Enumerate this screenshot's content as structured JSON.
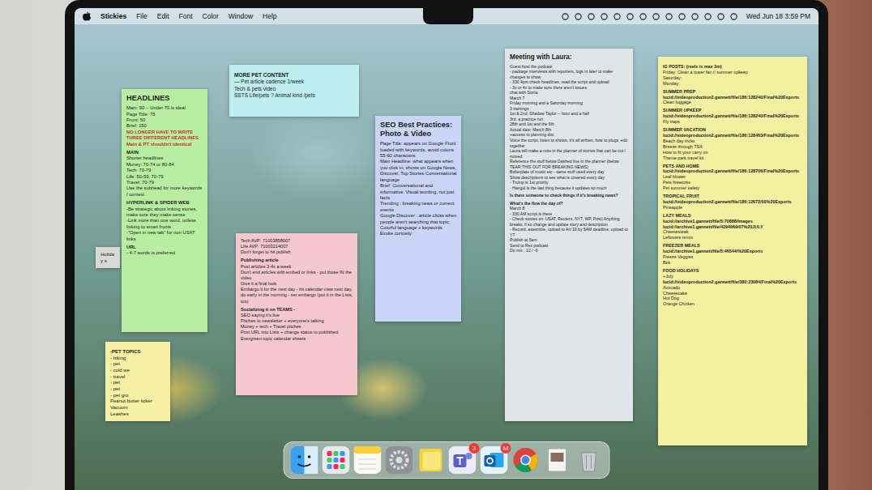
{
  "menubar": {
    "app": "Stickies",
    "menus": [
      "File",
      "Edit",
      "Font",
      "Color",
      "Window",
      "Help"
    ],
    "clock": "Wed Jun 18  3:59 PM"
  },
  "stickies": [
    {
      "color": "#d9d9d6",
      "lines": [
        {
          "text": "Holiday s",
          "kind": "text"
        }
      ]
    },
    {
      "color": "#f5f0a4",
      "lines": [
        {
          "text": "-PET TOPICS",
          "kind": "head"
        },
        {
          "text": "- hiking",
          "kind": "text"
        },
        {
          "text": "- pet",
          "kind": "text"
        },
        {
          "text": "- cold we",
          "kind": "text"
        },
        {
          "text": "- travel",
          "kind": "text"
        },
        {
          "text": "- pet",
          "kind": "text"
        },
        {
          "text": "- pet",
          "kind": "text"
        },
        {
          "text": "- pet gro",
          "kind": "text"
        },
        {
          "text": "Peanut butter licker",
          "kind": "text"
        },
        {
          "text": "Vacuum",
          "kind": "text"
        },
        {
          "text": "Leashes",
          "kind": "text"
        }
      ]
    },
    {
      "color": "#b8eea2",
      "lines": [
        {
          "text": "HEADLINES",
          "kind": "title"
        },
        {
          "text": "Main: 90 -- Under 70 is ideal",
          "kind": "text"
        },
        {
          "text": "Page Title: 75",
          "kind": "text"
        },
        {
          "text": "Front: 50",
          "kind": "text"
        },
        {
          "text": "Brief: 150",
          "kind": "text"
        },
        {
          "text": "NO LONGER HAVE TO WRITE THREE DIFFERENT HEADLINES",
          "kind": "red"
        },
        {
          "text": "Main & PT shouldn't identical",
          "kind": "red"
        },
        {
          "text": "MAIN",
          "kind": "head"
        },
        {
          "text": "Shorter headlines",
          "kind": "text"
        },
        {
          "text": "Money: 70-74 or 80-84",
          "kind": "text"
        },
        {
          "text": "Tech: 70-79",
          "kind": "text"
        },
        {
          "text": "Life: 50-59, 70-79",
          "kind": "text"
        },
        {
          "text": "Travel: 70-79",
          "kind": "text"
        },
        {
          "text": "Use the subhead for more keywords / context",
          "kind": "text"
        },
        {
          "text": "HYPERLINK & SPIDER WEB",
          "kind": "head"
        },
        {
          "text": "-Be strategic about linking stories, make sure they make sense",
          "kind": "text"
        },
        {
          "text": "-Link more than one word, unless linking to smart fronts",
          "kind": "text"
        },
        {
          "text": "-\"Open in new tab\" for non USAT links",
          "kind": "text"
        },
        {
          "text": "URL",
          "kind": "head"
        },
        {
          "text": "- 4-7 words is preferred",
          "kind": "text"
        }
      ]
    },
    {
      "color": "#bfeef0",
      "lines": [
        {
          "text": "MORE PET CONTENT",
          "kind": "head"
        },
        {
          "text": "— Pet article cadence 1/week",
          "kind": "text"
        },
        {
          "text": "Tech & pets video",
          "kind": "text"
        },
        {
          "text": "SSTS Life/pets ? Animal kind /pets",
          "kind": "text"
        }
      ]
    },
    {
      "color": "#f5c8d0",
      "lines": [
        {
          "text": "Tech AVP: 71003858007",
          "kind": "text"
        },
        {
          "text": "Life AVP: 71003214007",
          "kind": "text"
        },
        {
          "text": "Don't forget to hit publish",
          "kind": "text"
        },
        {
          "text": "Publishing article",
          "kind": "head"
        },
        {
          "text": "Post articles 3-4x a week",
          "kind": "text"
        },
        {
          "text": "Don't end articles with embed or links - put those IN the video",
          "kind": "text"
        },
        {
          "text": "Give it a final look",
          "kind": "text"
        },
        {
          "text": "Embargo it for the next day - hit calendar view next day, do early in the morning - set embargo (put it in the Lists, too)",
          "kind": "text"
        },
        {
          "text": "Socializing it on TEAMS -",
          "kind": "head"
        },
        {
          "text": "SEO saying it's live",
          "kind": "text"
        },
        {
          "text": "Pitches to newsletter + everyone's talking",
          "kind": "text"
        },
        {
          "text": "Money + tech + Travel pitches",
          "kind": "text"
        },
        {
          "text": "Post URL into Lists + change status to published",
          "kind": "text"
        },
        {
          "text": "Evergreen topic calendar sheets",
          "kind": "text"
        }
      ]
    },
    {
      "color": "#c9d4f6",
      "lines": [
        {
          "text": "SEO Best Practices: Photo & Video",
          "kind": "title"
        },
        {
          "text": "Page Title: appears on Google Front loaded with keywords, avoid colons 55-60 characters",
          "kind": "text"
        },
        {
          "text": "Main Headline: what appears when you click in, shows on Google News, Discover, Top Stories Conversational language",
          "kind": "text"
        },
        {
          "text": "Brief: Conversational and informative. Visual wording, not just facts",
          "kind": "text"
        },
        {
          "text": "Trending : breaking news or current events",
          "kind": "text"
        },
        {
          "text": "Google Discover : article clicks when people aren't searching that topic. Colorful language + keywords",
          "kind": "text"
        },
        {
          "text": "Evoke curiosity",
          "kind": "text"
        }
      ]
    },
    {
      "color": "#e2e5e8",
      "lines": [
        {
          "text": "Meeting with Laura:",
          "kind": "title"
        },
        {
          "text": "Guest host the podcast",
          "kind": "text"
        },
        {
          "text": "- package interviews with reporters, logs in later to make changes to show",
          "kind": "text"
        },
        {
          "text": "- 330 4pm check headlines, read the script and upload",
          "kind": "text"
        },
        {
          "text": "- 3x or 4x to make sure there aren't issues",
          "kind": "text"
        },
        {
          "text": "chat with Sonia",
          "kind": "text"
        },
        {
          "text": "March 7",
          "kind": "text"
        },
        {
          "text": "Friday morning and a Saturday morning",
          "kind": "text"
        },
        {
          "text": "3 trainings",
          "kind": "text"
        },
        {
          "text": "1st & 2nd: Shadow Taylor -- hour and a half",
          "kind": "text"
        },
        {
          "text": "3rd: a practice run",
          "kind": "text"
        },
        {
          "text": "28th and 1st and the 6th",
          "kind": "text"
        },
        {
          "text": "Actual date: March 8th",
          "kind": "text"
        },
        {
          "text": "+access to planning doc",
          "kind": "text"
        },
        {
          "text": "Voice the script, listen to shows, it's all written, how to plugs, edit together",
          "kind": "text"
        },
        {
          "text": "Laura will make a note in the planner of stories that can be cut / moved",
          "kind": "text"
        },
        {
          "text": "Reference the stuff below Dashed line in the planner (below TEAR THIS OUT FOR BREAKING NEWS)",
          "kind": "text"
        },
        {
          "text": "Boilerplate of music etc - same stuff used every day",
          "kind": "text"
        },
        {
          "text": "Show descriptions to see what is covered every day",
          "kind": "text"
        },
        {
          "text": "- Trump is 1st priority",
          "kind": "text"
        },
        {
          "text": "- Hangul is the last thing because it updates so much",
          "kind": "text"
        },
        {
          "text": "Is there someone to check things if it's breaking news?",
          "kind": "head"
        },
        {
          "text": "What's the flow the day of?",
          "kind": "head"
        },
        {
          "text": "March 8",
          "kind": "text"
        },
        {
          "text": "- 330 AM script is there",
          "kind": "text"
        },
        {
          "text": "- Check stories on: USAT, Reuters, NYT, WP, Post) Anything breaks, if so change and update story and description",
          "kind": "text"
        },
        {
          "text": "- Record, assemble, upload to Art 19 by 5AM deadline, upload to YT",
          "kind": "text"
        },
        {
          "text": "Publish at 5am",
          "kind": "text"
        },
        {
          "text": "Send to Rex podcast",
          "kind": "text"
        },
        {
          "text": "Do mix : 12 / -6",
          "kind": "text"
        }
      ]
    },
    {
      "color": "#f4f0a2",
      "lines": [
        {
          "text": "IG POSTS: (reels is max 3m)",
          "kind": "head"
        },
        {
          "text": "Friday: Clean a tower fan // summer upkeep",
          "kind": "text"
        },
        {
          "text": "Saturday:",
          "kind": "text"
        },
        {
          "text": "Monday:",
          "kind": "text"
        },
        {
          "text": "SUMMER PREP",
          "kind": "head"
        },
        {
          "text": "lucid://videoproduction2.gannett/file/186:128240/Final%20Exports",
          "kind": "link"
        },
        {
          "text": "Clean luggage",
          "kind": "text"
        },
        {
          "text": "SUMMER UPKEEP",
          "kind": "head"
        },
        {
          "text": "lucid://videoproduction2.gannett/file/186:128240/Final%20Exports",
          "kind": "link"
        },
        {
          "text": "Fly traps",
          "kind": "text"
        },
        {
          "text": "SUMMER VACATION",
          "kind": "head"
        },
        {
          "text": "lucid://videoproduction2.gannett/file/186:128463/Final%20Exports",
          "kind": "link"
        },
        {
          "text": "Beach day tricks",
          "kind": "text"
        },
        {
          "text": "Breeze through TSA",
          "kind": "text"
        },
        {
          "text": "How to fit your carry on",
          "kind": "text"
        },
        {
          "text": "Theme park travel kit",
          "kind": "text"
        },
        {
          "text": "PETS AND HOME",
          "kind": "head"
        },
        {
          "text": "lucid://videoproduction2.gannett/file/186:128706/Final%20Exports",
          "kind": "link"
        },
        {
          "text": "Leaf blower",
          "kind": "text"
        },
        {
          "text": "Pets fireworks",
          "kind": "text"
        },
        {
          "text": "Pet summer safety",
          "kind": "text"
        },
        {
          "text": "TROPICAL FRUIT",
          "kind": "head"
        },
        {
          "text": "lucid://videoproduction2.gannett/file/186:12672/00%20Exports",
          "kind": "link"
        },
        {
          "text": "Pineapple",
          "kind": "text"
        },
        {
          "text": "LAZY MEALS",
          "kind": "head"
        },
        {
          "text": "lucid://archive1.gannett/file/5:70888/Images",
          "kind": "link"
        },
        {
          "text": "lucid://archive1.gannett/file/4294069/07%20JULY",
          "kind": "link"
        },
        {
          "text": "Cheesesteak",
          "kind": "text"
        },
        {
          "text": "Leftovers remix",
          "kind": "text"
        },
        {
          "text": "FREEZER MEALS",
          "kind": "head"
        },
        {
          "text": "lucid://archive1.gannett/file/5:46544/%20Exports",
          "kind": "link"
        },
        {
          "text": "Freeze Veggies",
          "kind": "text"
        },
        {
          "text": "Bok",
          "kind": "text"
        },
        {
          "text": "FOOD HOLIDAYS",
          "kind": "head"
        },
        {
          "text": "+July",
          "kind": "text"
        },
        {
          "text": "lucid://videoproduction2.gannett/file/380:23084/Final%20Exports",
          "kind": "link"
        },
        {
          "text": "Avocado",
          "kind": "text"
        },
        {
          "text": "Cheesecake",
          "kind": "text"
        },
        {
          "text": "Hot Dog",
          "kind": "text"
        },
        {
          "text": "Orange Chicken",
          "kind": "text"
        }
      ]
    }
  ],
  "dock": [
    {
      "kind": "finder",
      "badge": ""
    },
    {
      "kind": "launchpad",
      "badge": ""
    },
    {
      "kind": "notes",
      "badge": ""
    },
    {
      "kind": "settings",
      "badge": ""
    },
    {
      "kind": "stickies",
      "badge": ""
    },
    {
      "kind": "teams",
      "badge": "3"
    },
    {
      "kind": "outlook",
      "badge": "M"
    },
    {
      "kind": "chrome",
      "badge": ""
    },
    {
      "kind": "preview",
      "badge": ""
    },
    {
      "kind": "trash",
      "badge": ""
    }
  ]
}
